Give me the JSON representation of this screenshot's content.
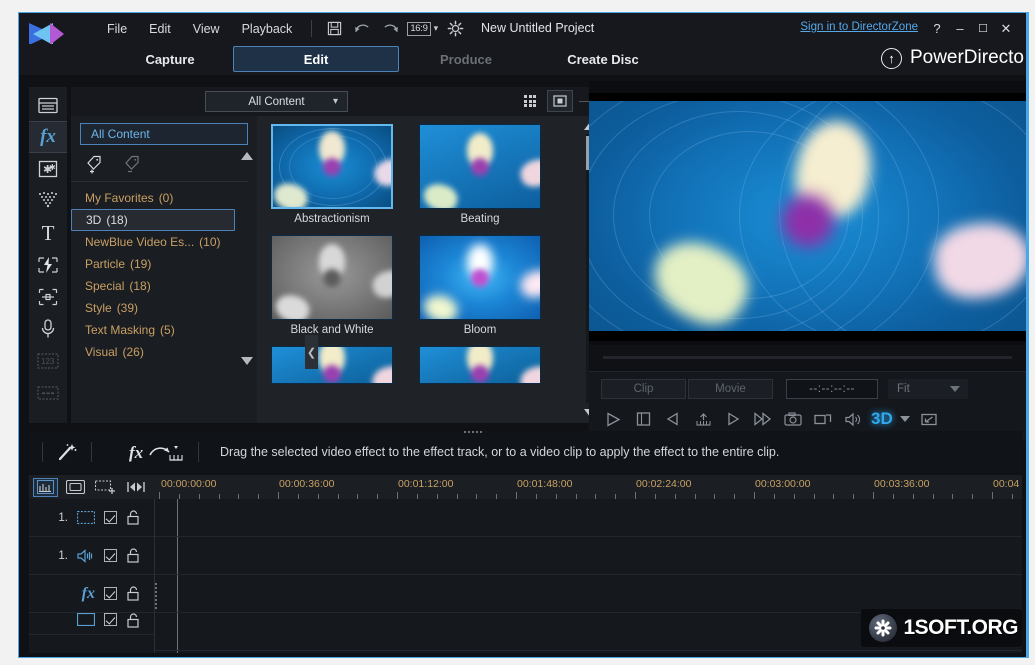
{
  "window": {
    "title": "New Untitled Project",
    "signin_link": "Sign in to DirectorZone",
    "help_label": "?",
    "minimize_label": "–",
    "maximize_label": "☐",
    "close_label": "✕",
    "brand": "PowerDirecto",
    "accent_color": "#4aa8e8"
  },
  "menubar": {
    "items": [
      "File",
      "Edit",
      "View",
      "Playback"
    ],
    "save_icon": "save-icon",
    "undo_icon": "undo-icon",
    "redo_icon": "redo-icon",
    "aspect_ratio": "16:9",
    "settings_icon": "gear-icon"
  },
  "tabs": [
    {
      "label": "Capture",
      "state": "normal"
    },
    {
      "label": "Edit",
      "state": "active"
    },
    {
      "label": "Produce",
      "state": "disabled"
    },
    {
      "label": "Create Disc",
      "state": "normal"
    }
  ],
  "rail": [
    {
      "name": "media-room",
      "icon": "film-clapper-icon",
      "state": "normal"
    },
    {
      "name": "effect-room",
      "icon": "fx-icon",
      "state": "selected"
    },
    {
      "name": "pip-objects-room",
      "icon": "star-frame-icon",
      "state": "normal"
    },
    {
      "name": "particle-room",
      "icon": "particle-icon",
      "state": "normal"
    },
    {
      "name": "title-room",
      "icon": "text-t-icon",
      "state": "normal"
    },
    {
      "name": "transition-room",
      "icon": "transition-bolt-icon",
      "state": "normal"
    },
    {
      "name": "audio-mixing-room",
      "icon": "audio-mix-icon",
      "state": "normal"
    },
    {
      "name": "voice-over-room",
      "icon": "microphone-icon",
      "state": "normal"
    },
    {
      "name": "chapter-room",
      "icon": "chapter-grid-icon",
      "state": "disabled"
    },
    {
      "name": "subtitle-room",
      "icon": "subtitle-icon",
      "state": "disabled"
    }
  ],
  "library": {
    "filter_selected": "All Content",
    "all_content_button": "All Content",
    "view_grid_icon": "grid-sort-icon",
    "view_single_icon": "single-view-icon",
    "add_tag_icon": "add-tag-icon",
    "remove_tag_icon": "remove-tag-icon",
    "collapse_icon": "chevron-left-icon",
    "categories": [
      {
        "label": "My Favorites",
        "count": "(0)",
        "selected": false
      },
      {
        "label": "3D",
        "count": "(18)",
        "selected": true
      },
      {
        "label": "NewBlue Video Es...",
        "count": "(10)",
        "selected": false
      },
      {
        "label": "Particle",
        "count": "(19)",
        "selected": false
      },
      {
        "label": "Special",
        "count": "(18)",
        "selected": false
      },
      {
        "label": "Style",
        "count": "(39)",
        "selected": false
      },
      {
        "label": "Text Masking",
        "count": "(5)",
        "selected": false
      },
      {
        "label": "Visual",
        "count": "(26)",
        "selected": false
      }
    ],
    "effects": [
      {
        "label": "Abstractionism",
        "selected": true,
        "style": "abstract"
      },
      {
        "label": "Beating",
        "selected": false,
        "style": "plain"
      },
      {
        "label": "Black and White",
        "selected": false,
        "style": "bw"
      },
      {
        "label": "Bloom",
        "selected": false,
        "style": "bloom"
      },
      {
        "label": "",
        "selected": false,
        "style": "plain"
      },
      {
        "label": "",
        "selected": false,
        "style": "plain"
      }
    ]
  },
  "preview": {
    "clip_tab": "Clip",
    "movie_tab": "Movie",
    "timecode": "--:--:--:--",
    "fit_label": "Fit",
    "mode_3d_label": "3D",
    "buttons": [
      "play-icon",
      "stop-icon",
      "previous-frame-icon",
      "step-marker-icon",
      "next-frame-icon",
      "fast-forward-icon",
      "snapshot-icon",
      "popout-preview-icon",
      "volume-icon"
    ],
    "fullscreen_icon": "fullscreen-icon"
  },
  "message_bar": {
    "magic_tools_icon": "magic-wand-icon",
    "fx_track_icon": "fx-to-track-icon",
    "text": "Drag the selected video effect to the effect track, or to a video clip to apply the effect to the entire clip."
  },
  "timeline": {
    "toolbar": [
      {
        "name": "timeline-view-button",
        "icon": "timeline-ruler-icon",
        "selected": true
      },
      {
        "name": "storyboard-view-button",
        "icon": "storyboard-icon",
        "selected": false
      },
      {
        "name": "add-track-button",
        "icon": "add-track-icon",
        "selected": false
      },
      {
        "name": "track-manager-button",
        "icon": "track-manager-icon",
        "selected": false
      }
    ],
    "ruler_labels": [
      "00:00:00:00",
      "00:00:36:00",
      "00:01:12:00",
      "00:01:48:00",
      "00:02:24:00",
      "00:03:00:00",
      "00:03:36:00",
      "00:04"
    ],
    "tracks": [
      {
        "number": "1.",
        "icon": "video-track-icon",
        "enabled": true,
        "locked": false
      },
      {
        "number": "1.",
        "icon": "audio-track-icon",
        "enabled": true,
        "locked": false
      },
      {
        "number": "",
        "icon": "fx-track-icon",
        "enabled": true,
        "locked": false
      },
      {
        "number": "",
        "icon": "pip-track-icon",
        "enabled": true,
        "locked": false
      }
    ]
  },
  "watermark": {
    "icon": "gear-icon",
    "text": "1SOFT.ORG"
  }
}
